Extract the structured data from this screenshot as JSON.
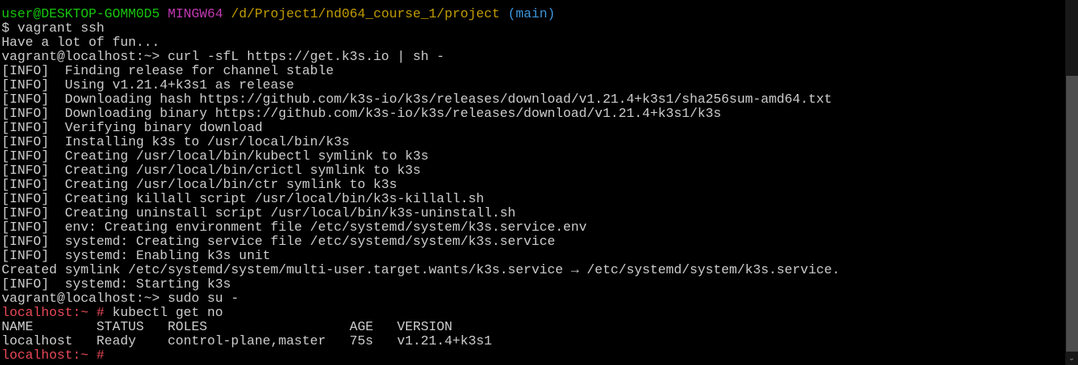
{
  "terminal": {
    "lines": [
      [
        {
          "t": "user@DESKTOP-GOMM0D5",
          "c": "green"
        },
        {
          "t": " ",
          "c": "default"
        },
        {
          "t": "MINGW64",
          "c": "magenta"
        },
        {
          "t": " ",
          "c": "default"
        },
        {
          "t": "/d/Project1/nd064_course_1/project",
          "c": "yellow"
        },
        {
          "t": " ",
          "c": "default"
        },
        {
          "t": "(main)",
          "c": "cyan"
        }
      ],
      [
        {
          "t": "$ vagrant ssh",
          "c": "default"
        }
      ],
      [
        {
          "t": "Have a lot of fun...",
          "c": "default"
        }
      ],
      [
        {
          "t": "vagrant@localhost:~> curl -sfL https://get.k3s.io | sh -",
          "c": "default"
        }
      ],
      [
        {
          "t": "[INFO]  Finding release for channel stable",
          "c": "default"
        }
      ],
      [
        {
          "t": "[INFO]  Using v1.21.4+k3s1 as release",
          "c": "default"
        }
      ],
      [
        {
          "t": "[INFO]  Downloading hash https://github.com/k3s-io/k3s/releases/download/v1.21.4+k3s1/sha256sum-amd64.txt",
          "c": "default"
        }
      ],
      [
        {
          "t": "[INFO]  Downloading binary https://github.com/k3s-io/k3s/releases/download/v1.21.4+k3s1/k3s",
          "c": "default"
        }
      ],
      [
        {
          "t": "[INFO]  Verifying binary download",
          "c": "default"
        }
      ],
      [
        {
          "t": "[INFO]  Installing k3s to /usr/local/bin/k3s",
          "c": "default"
        }
      ],
      [
        {
          "t": "[INFO]  Creating /usr/local/bin/kubectl symlink to k3s",
          "c": "default"
        }
      ],
      [
        {
          "t": "[INFO]  Creating /usr/local/bin/crictl symlink to k3s",
          "c": "default"
        }
      ],
      [
        {
          "t": "[INFO]  Creating /usr/local/bin/ctr symlink to k3s",
          "c": "default"
        }
      ],
      [
        {
          "t": "[INFO]  Creating killall script /usr/local/bin/k3s-killall.sh",
          "c": "default"
        }
      ],
      [
        {
          "t": "[INFO]  Creating uninstall script /usr/local/bin/k3s-uninstall.sh",
          "c": "default"
        }
      ],
      [
        {
          "t": "[INFO]  env: Creating environment file /etc/systemd/system/k3s.service.env",
          "c": "default"
        }
      ],
      [
        {
          "t": "[INFO]  systemd: Creating service file /etc/systemd/system/k3s.service",
          "c": "default"
        }
      ],
      [
        {
          "t": "[INFO]  systemd: Enabling k3s unit",
          "c": "default"
        }
      ],
      [
        {
          "t": "Created symlink /etc/systemd/system/multi-user.target.wants/k3s.service → /etc/systemd/system/k3s.service.",
          "c": "default"
        }
      ],
      [
        {
          "t": "[INFO]  systemd: Starting k3s",
          "c": "default"
        }
      ],
      [
        {
          "t": "vagrant@localhost:~> sudo su -",
          "c": "default"
        }
      ],
      [
        {
          "t": "localhost:~ #",
          "c": "red"
        },
        {
          "t": " kubectl get no",
          "c": "default"
        }
      ],
      [
        {
          "t": "NAME        STATUS   ROLES                  AGE   VERSION",
          "c": "default"
        }
      ],
      [
        {
          "t": "localhost   Ready    control-plane,master   75s   v1.21.4+k3s1",
          "c": "default"
        }
      ],
      [
        {
          "t": "localhost:~ #",
          "c": "red"
        },
        {
          "t": " ",
          "c": "default"
        }
      ]
    ]
  },
  "scrollbar": {
    "down_arrow_icon": "chevron-down-icon",
    "position_fraction": 1.0
  }
}
